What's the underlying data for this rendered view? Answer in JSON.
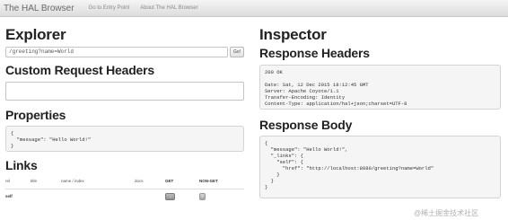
{
  "navbar": {
    "brand": "The HAL Browser",
    "links": [
      "Go to Entry Point",
      "About The HAL Browser"
    ]
  },
  "explorer": {
    "title": "Explorer",
    "url_value": "/greeting?name=World",
    "go_label": "Go!",
    "custom_headers_title": "Custom Request Headers",
    "custom_headers_value": "",
    "properties_title": "Properties",
    "properties_json": "{\n  \"message\": \"Hello World!\"\n}",
    "links_title": "Links",
    "links_columns": [
      "rel",
      "title",
      "name / index",
      "docs",
      "GET",
      "NON-GET"
    ],
    "links_rows": [
      {
        "rel": "self",
        "title": "",
        "name": "",
        "docs": "",
        "get": "→",
        "non_get": "!"
      }
    ]
  },
  "inspector": {
    "title": "Inspector",
    "response_headers_title": "Response Headers",
    "response_headers": "200 OK\n\nDate: Sat, 12 Dec 2015 18:12:45 GMT\nServer: Apache Coyote/1.1\nTransfer-Encoding: Identity\nContent-Type: application/hal+json;charset=UTF-8",
    "response_body_title": "Response Body",
    "response_body": "{\n  \"message\": \"Hello World!\",\n  \"_links\": {\n    \"self\": {\n      \"href\": \"http://localhost:8080/greeting?name=World\"\n    }\n  }\n}"
  },
  "watermark": "@稀土掘金技术社区"
}
